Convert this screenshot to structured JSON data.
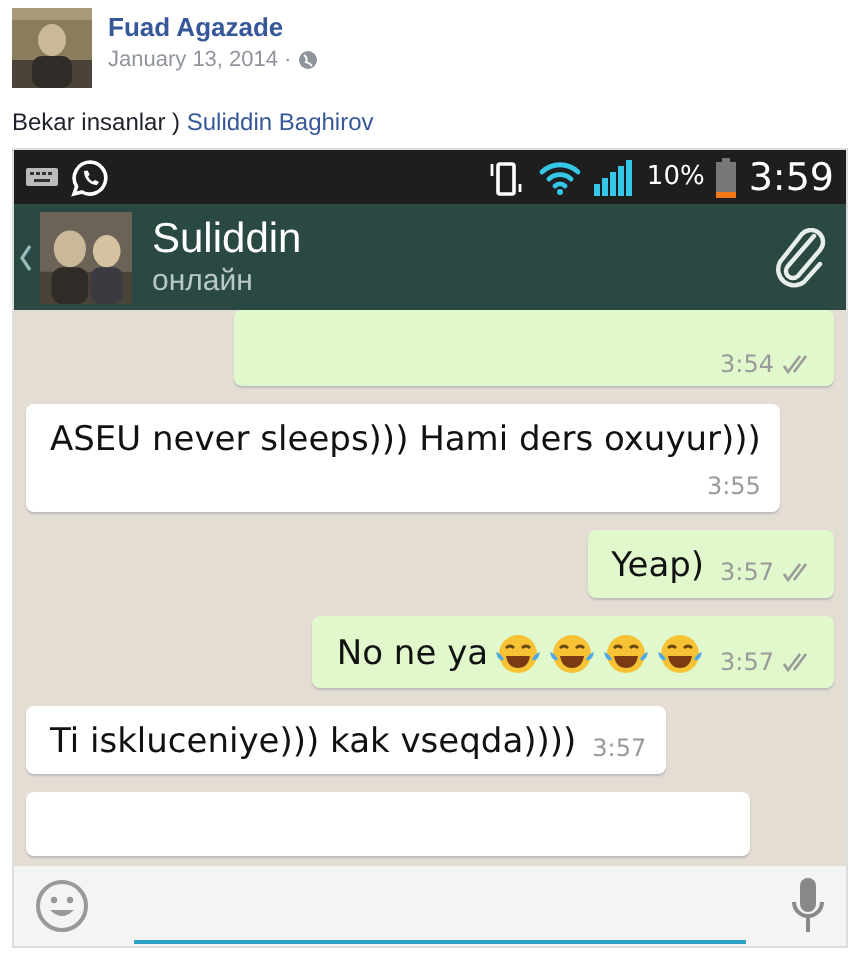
{
  "post": {
    "author": "Fuad Agazade",
    "date": "January 13, 2014",
    "separator": "·",
    "text": "Bekar insanlar )",
    "tag": "Suliddin Baghirov"
  },
  "status_bar": {
    "battery": "10%",
    "time": "3:59"
  },
  "chat_header": {
    "name": "Suliddin",
    "status": "онлайн"
  },
  "messages": [
    {
      "kind": "outgoing",
      "time": "3:54",
      "ticks": true
    },
    {
      "kind": "incoming",
      "text": "ASEU never sleeps))) Hami ders oxuyur)))",
      "time": "3:55",
      "ticks": false,
      "time_below": true
    },
    {
      "kind": "outgoing",
      "text": "Yeap)",
      "time": "3:57",
      "ticks": true
    },
    {
      "kind": "outgoing",
      "text": "No ne ya",
      "emojis": [
        {
          "kind": "tears-of-joy"
        },
        {
          "kind": "tears-of-joy"
        },
        {
          "kind": "tears-of-joy"
        },
        {
          "kind": "tears-of-joy"
        }
      ],
      "time": "3:57",
      "ticks": true
    },
    {
      "kind": "incoming",
      "text": "Ti iskluceniye))) kak vseqda))))",
      "time": "3:57",
      "ticks": false
    },
    {
      "kind": "incoming"
    }
  ]
}
